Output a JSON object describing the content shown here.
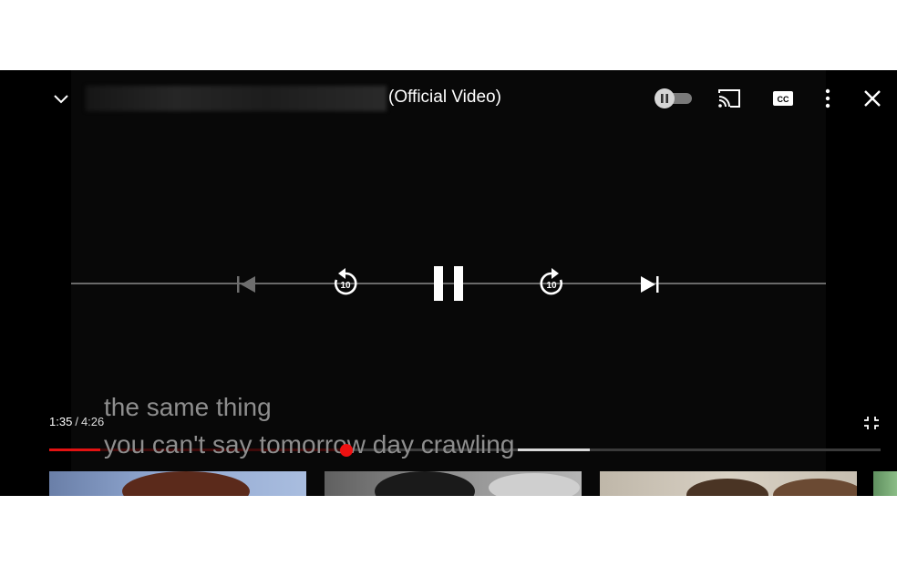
{
  "header": {
    "title": "(Official Video)",
    "collapse_icon": "chevron-down-icon",
    "autoplay_icon": "autoplay-toggle-icon",
    "cast_icon": "cast-icon",
    "captions_icon": "closed-captions-icon",
    "captions_label": "CC",
    "more_icon": "more-vertical-icon",
    "close_icon": "close-icon"
  },
  "controls": {
    "previous_icon": "skip-previous-icon",
    "rewind_icon": "replay-10-icon",
    "rewind_seconds": "10",
    "pause_icon": "pause-icon",
    "forward_icon": "forward-10-icon",
    "forward_seconds": "10",
    "next_icon": "skip-next-icon"
  },
  "playback": {
    "current_time": "1:35",
    "separator": "/",
    "duration": "4:26",
    "played_fraction": 0.357,
    "buffered_fraction": 0.65,
    "fullscreen_icon": "exit-fullscreen-icon"
  },
  "captions": {
    "line1": "the same thing",
    "line2": "you can't say tomorrow day crawling"
  },
  "colors": {
    "progress_played": "#e31212",
    "progress_buffered": "#d8d8d8",
    "background": "#000000"
  }
}
